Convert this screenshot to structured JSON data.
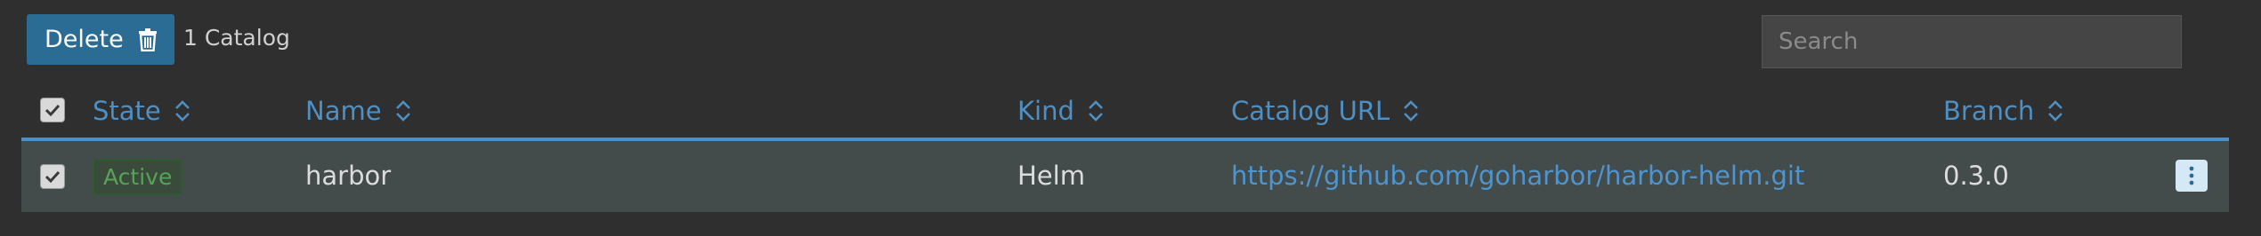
{
  "toolbar": {
    "delete_label": "Delete",
    "selection_count": "1 Catalog"
  },
  "search": {
    "placeholder": "Search"
  },
  "table": {
    "headers": {
      "state": "State",
      "name": "Name",
      "kind": "Kind",
      "catalog_url": "Catalog URL",
      "branch": "Branch"
    },
    "rows": [
      {
        "state": "Active",
        "name": "harbor",
        "kind": "Helm",
        "catalog_url": "https://github.com/goharbor/harbor-helm.git",
        "branch": "0.3.0",
        "selected": true
      }
    ]
  },
  "colors": {
    "accent": "#2a6c93",
    "link": "#4e95cf",
    "active": "#56a35a",
    "background": "#2f2f2f"
  },
  "icons": [
    "trash-icon",
    "sort-icon",
    "checkmark-icon",
    "kebab-menu-icon"
  ]
}
